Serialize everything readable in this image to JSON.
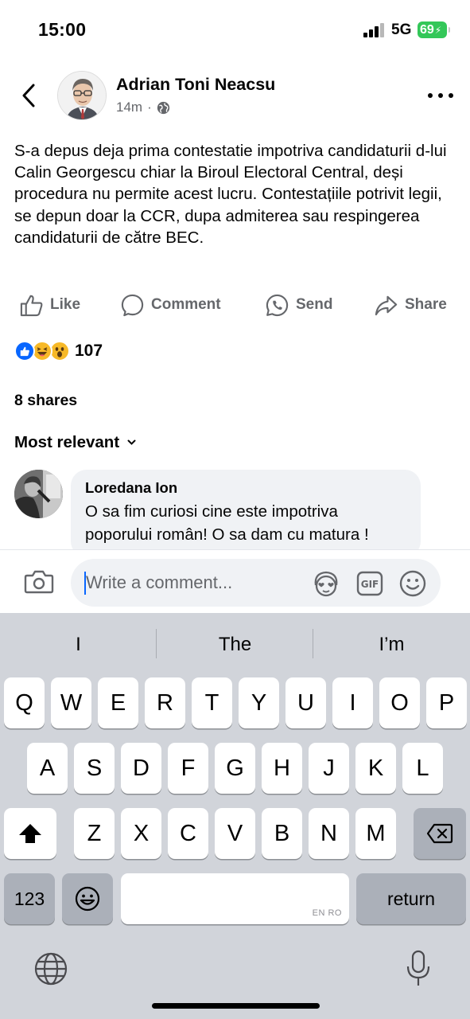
{
  "status_bar": {
    "time": "15:00",
    "network": "5G",
    "battery": "69"
  },
  "post": {
    "author": "Adrian Toni Neacsu",
    "time": "14m",
    "separator": "·",
    "text": "S-a depus deja prima contestatie impotriva candidaturii d-lui Calin Georgescu chiar la Biroul Electoral Central, deși procedura nu permite acest lucru. Contestațiile potrivit legii, se depun doar la CCR, dupa admiterea sau respingerea candidaturii de către BEC."
  },
  "actions": {
    "like": "Like",
    "comment": "Comment",
    "send": "Send",
    "share": "Share"
  },
  "reactions": {
    "count": "107"
  },
  "shares": "8 shares",
  "sort": {
    "label": "Most relevant"
  },
  "comment": {
    "name": "Loredana Ion",
    "text": "O sa fim curiosi cine este impotriva poporului român! O sa dam cu matura !"
  },
  "composer": {
    "placeholder": "Write a comment..."
  },
  "keyboard": {
    "suggestions": [
      "I",
      "The",
      "I’m"
    ],
    "rows": [
      [
        "Q",
        "W",
        "E",
        "R",
        "T",
        "Y",
        "U",
        "I",
        "O",
        "P"
      ],
      [
        "A",
        "S",
        "D",
        "F",
        "G",
        "H",
        "J",
        "K",
        "L"
      ],
      [
        "Z",
        "X",
        "C",
        "V",
        "B",
        "N",
        "M"
      ]
    ],
    "numbers_key": "123",
    "space_lang": "EN RO",
    "return_key": "return"
  },
  "colors": {
    "accent_blue": "#0866ff",
    "secondary_text": "#65676b",
    "keyboard_bg": "#d1d4da",
    "battery_green": "#34c759"
  }
}
